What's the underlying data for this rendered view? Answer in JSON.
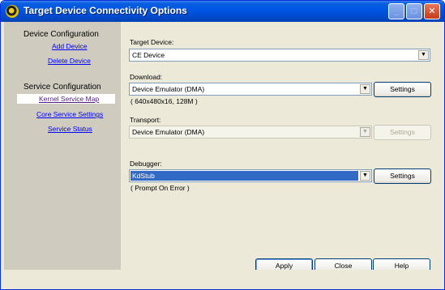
{
  "window": {
    "title": "Target Device Connectivity Options",
    "controls": {
      "minimize": "_",
      "maximize": "□",
      "close": "✕"
    }
  },
  "sidebar": {
    "device_section": "Device Configuration",
    "device_links": [
      "Add Device",
      "Delete Device"
    ],
    "service_section": "Service Configuration",
    "service_links": [
      "Kernel Service Map",
      "Core Service Settings",
      "Service Status"
    ],
    "selected": "Kernel Service Map"
  },
  "form": {
    "target_device": {
      "label": "Target Device:",
      "value": "CE Device"
    },
    "download": {
      "label": "Download:",
      "value": "Device Emulator (DMA)",
      "info": "( 640x480x16, 128M )",
      "settings": "Settings"
    },
    "transport": {
      "label": "Transport:",
      "value": "Device Emulator (DMA)",
      "settings": "Settings"
    },
    "debugger": {
      "label": "Debugger:",
      "value": "KdStub",
      "info": "( Prompt On Error )",
      "settings": "Settings"
    }
  },
  "buttons": {
    "apply": "Apply",
    "close": "Close",
    "help": "Help"
  },
  "icons": {
    "dropdown": "chevron-down-icon",
    "app": "app-icon"
  }
}
